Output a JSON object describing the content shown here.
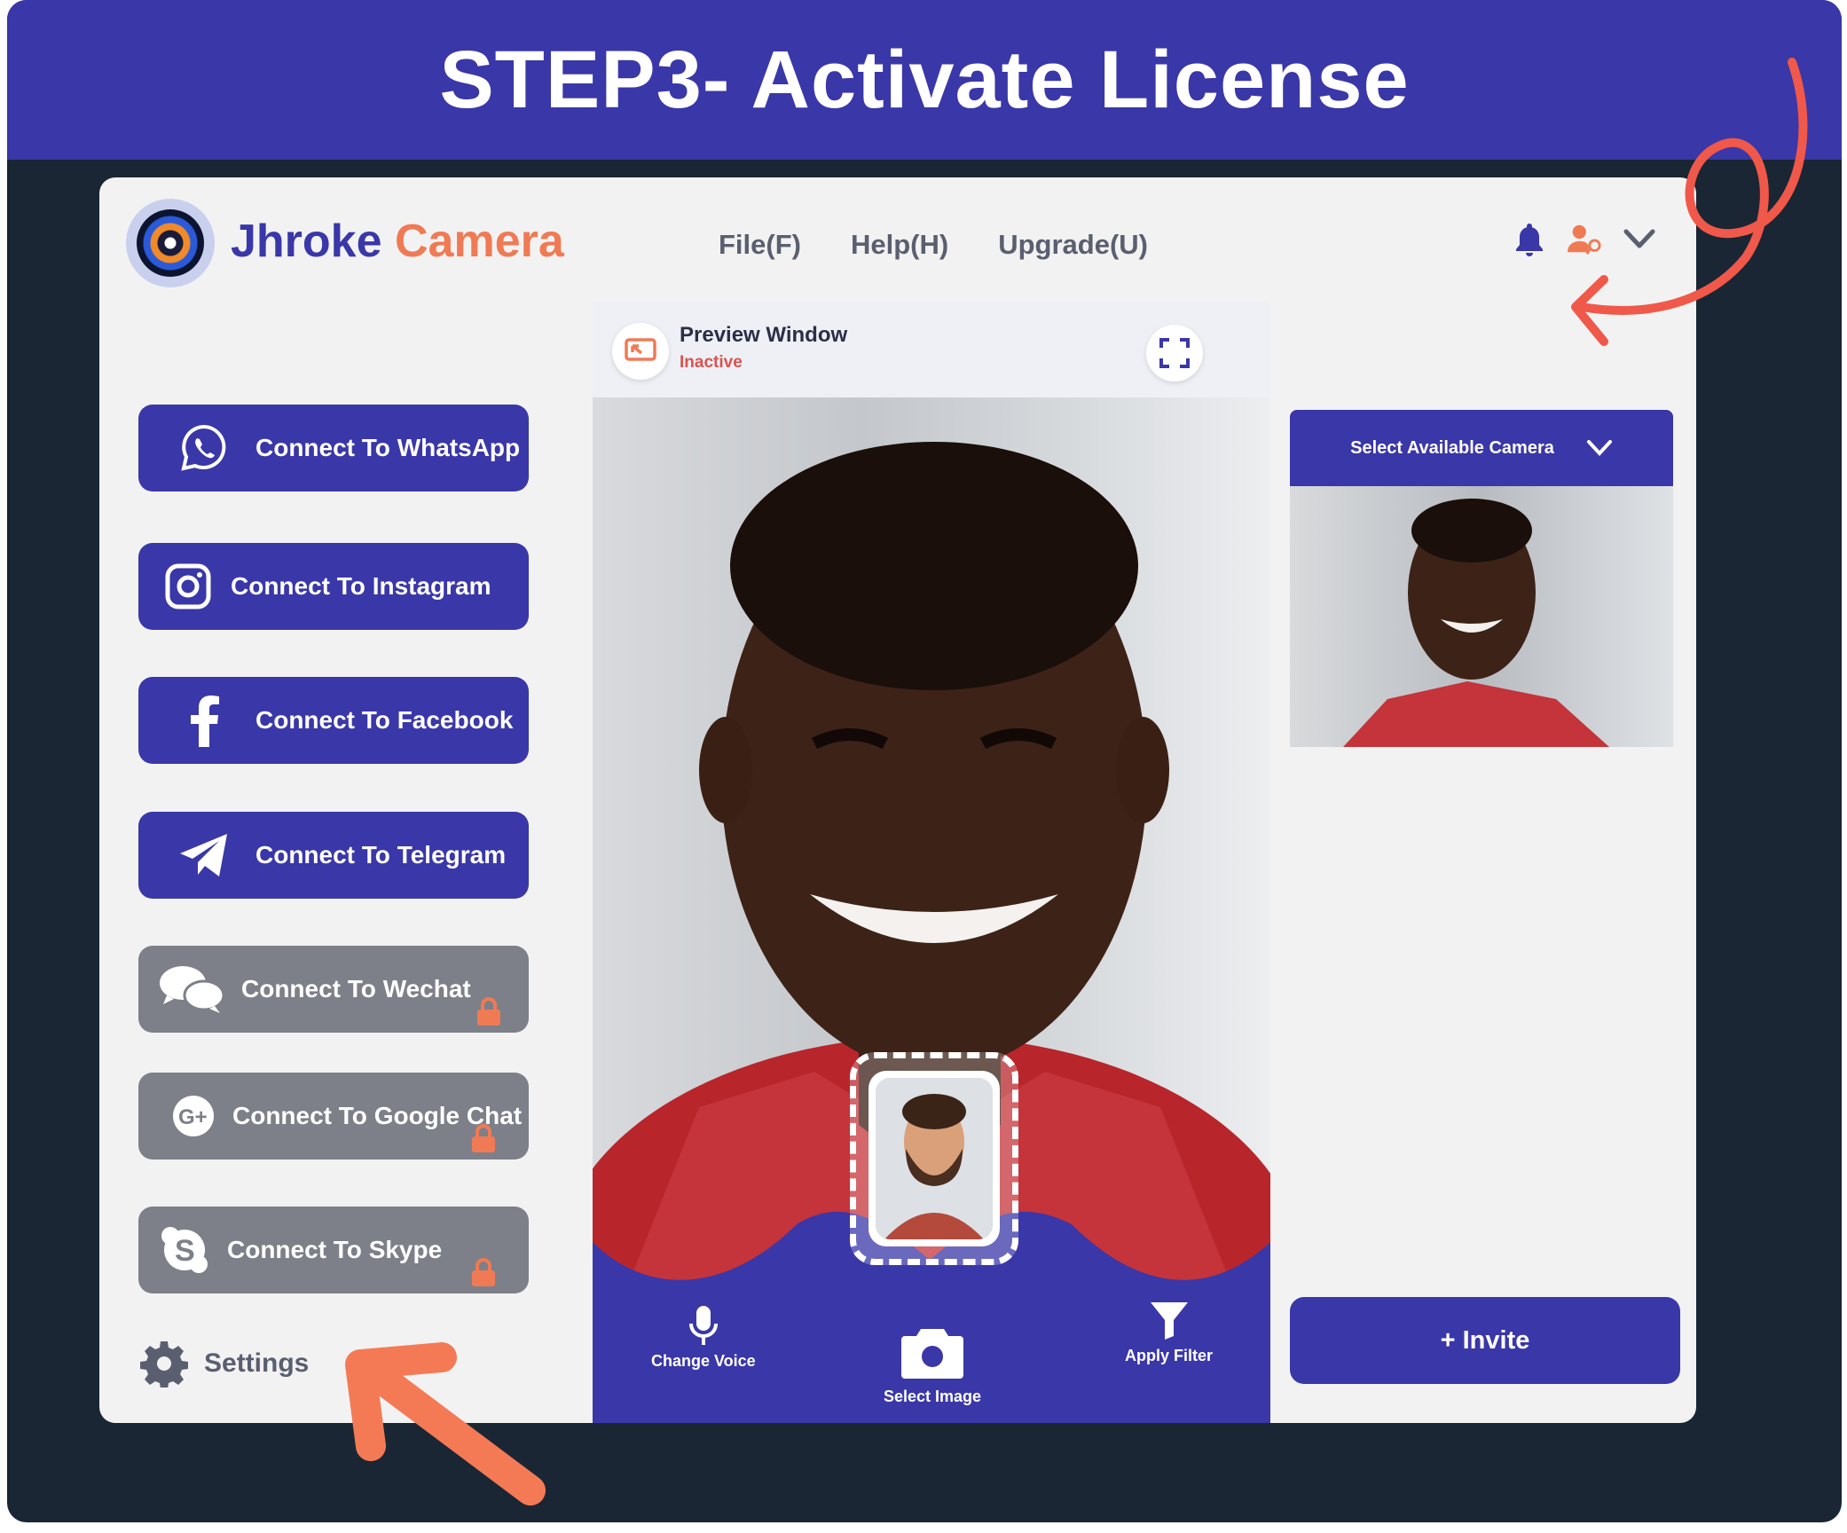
{
  "banner": {
    "title": "STEP3- Activate License"
  },
  "app": {
    "brand_part1": "Jhroke",
    "brand_part2": "Camera",
    "menu": [
      {
        "label": "File(F)"
      },
      {
        "label": "Help(H)"
      },
      {
        "label": "Upgrade(U)"
      }
    ],
    "top_icons": [
      "bell-icon",
      "user-key-icon",
      "chevron-down-icon"
    ]
  },
  "sidebar": {
    "buttons": [
      {
        "label": "Connect To WhatsApp",
        "icon": "whatsapp-icon",
        "locked": false
      },
      {
        "label": "Connect To Instagram",
        "icon": "instagram-icon",
        "locked": false
      },
      {
        "label": "Connect To Facebook",
        "icon": "facebook-icon",
        "locked": false
      },
      {
        "label": "Connect To Telegram",
        "icon": "telegram-icon",
        "locked": false
      },
      {
        "label": "Connect To Wechat",
        "icon": "wechat-icon",
        "locked": true
      },
      {
        "label": "Connect To Google Chat",
        "icon": "google-chat-icon",
        "locked": true
      },
      {
        "label": "Connect To Skype",
        "icon": "skype-icon",
        "locked": true
      }
    ],
    "settings_label": "Settings"
  },
  "preview": {
    "title": "Preview Window",
    "status": "Inactive",
    "controls": {
      "change_voice": "Change Voice",
      "select_image": "Select Image",
      "apply_filter": "Apply Filter"
    }
  },
  "camera_panel": {
    "select_label": "Select Available Camera"
  },
  "invite_label": "+ Invite",
  "colors": {
    "primary": "#3a37a8",
    "accent": "#f07a54",
    "locked": "#7d8089",
    "frame": "#1a2634",
    "panel": "#f2f2f2",
    "status_inactive": "#d9534f"
  }
}
